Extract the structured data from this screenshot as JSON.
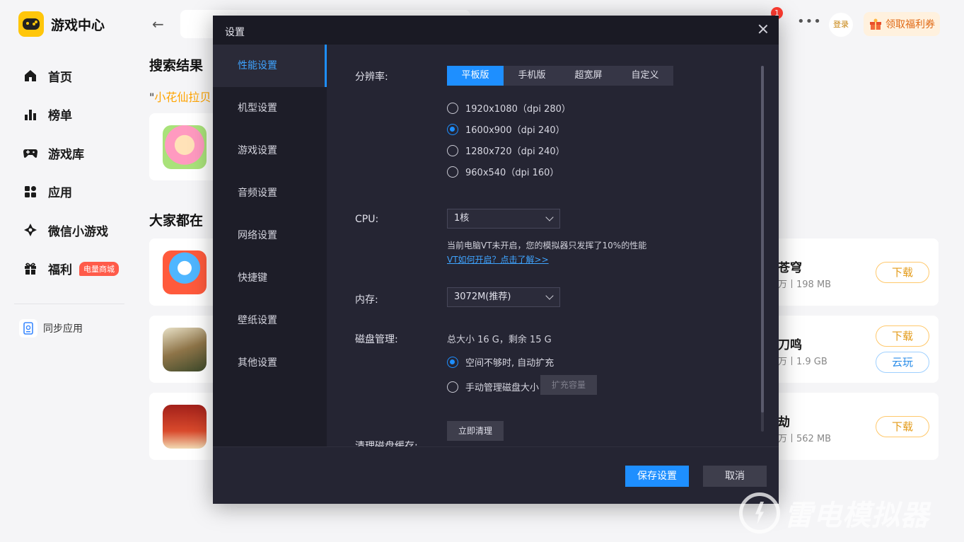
{
  "app": {
    "title": "游戏中心"
  },
  "sidebar": {
    "items": [
      {
        "label": "首页",
        "icon": "home-icon"
      },
      {
        "label": "榜单",
        "icon": "ranking-icon"
      },
      {
        "label": "游戏库",
        "icon": "gamepad-icon"
      },
      {
        "label": "应用",
        "icon": "apps-icon"
      },
      {
        "label": "微信小游戏",
        "icon": "wechat-game-icon"
      },
      {
        "label": "福利",
        "icon": "gift-icon",
        "badge": "电量商城"
      }
    ],
    "sync_label": "同步应用"
  },
  "header": {
    "notification_count": "1",
    "login_label": "登录",
    "coupon_label": "领取福利券"
  },
  "main": {
    "search_results_title": "搜索结果",
    "query_open": "\"",
    "query_text": "小花仙拉贝",
    "popular_title": "大家都在",
    "games": [
      {
        "name": "苍穹",
        "meta": "万丨198 MB",
        "download": "下载"
      },
      {
        "name": "刀鸣",
        "meta": "万丨1.9 GB",
        "download": "下载",
        "cloud": "云玩"
      },
      {
        "name": "劫",
        "meta": "万丨562 MB",
        "download": "下载"
      }
    ]
  },
  "dialog": {
    "title": "设置",
    "nav": [
      "性能设置",
      "机型设置",
      "游戏设置",
      "音频设置",
      "网络设置",
      "快捷键",
      "壁纸设置",
      "其他设置"
    ],
    "resolution": {
      "label": "分辨率:",
      "tabs": [
        "平板版",
        "手机版",
        "超宽屏",
        "自定义"
      ],
      "options": [
        "1920x1080（dpi 280）",
        "1600x900（dpi 240）",
        "1280x720（dpi 240）",
        "960x540（dpi 160）"
      ],
      "selected_index": 1
    },
    "cpu": {
      "label": "CPU:",
      "value": "1核",
      "note": "当前电脑VT未开启，您的模拟器只发挥了10%的性能",
      "link": "VT如何开启？点击了解>>"
    },
    "memory": {
      "label": "内存:",
      "value": "3072M(推荐)"
    },
    "disk": {
      "label": "磁盘管理:",
      "summary": "总大小 16 G，剩余 15 G",
      "options": [
        "空间不够时, 自动扩充",
        "手动管理磁盘大小"
      ],
      "expand_label": "扩充容量"
    },
    "cache": {
      "label": "清理磁盘缓存:",
      "button": "立即清理"
    },
    "save_label": "保存设置",
    "cancel_label": "取消"
  },
  "watermark": {
    "text": "雷电模拟器"
  },
  "colors": {
    "accent": "#1e8fff",
    "brand": "#ffc60a",
    "download": "#e39a17"
  }
}
